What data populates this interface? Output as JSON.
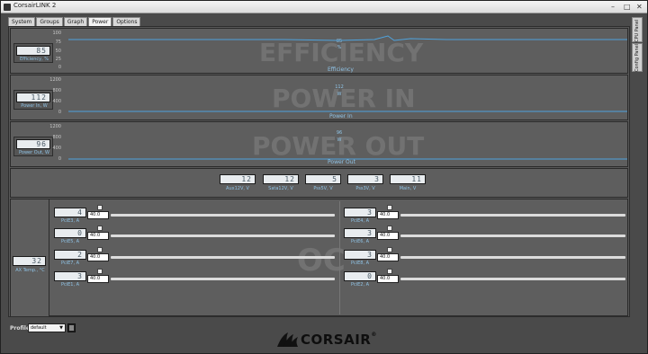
{
  "window": {
    "title": "CorsairLINK 2",
    "min": "–",
    "max": "□",
    "close": "✕"
  },
  "tabs": [
    {
      "label": "System"
    },
    {
      "label": "Groups"
    },
    {
      "label": "Graph"
    },
    {
      "label": "Power"
    },
    {
      "label": "Options"
    }
  ],
  "side_tabs": {
    "config": "Config Panel",
    "cpu": "CPU Panel"
  },
  "gauges": {
    "efficiency": {
      "value": "85",
      "label": "Efficiency, %"
    },
    "power_in": {
      "value": "112",
      "label": "Power In, W"
    },
    "power_out": {
      "value": "96",
      "label": "Power Out, W"
    },
    "temp": {
      "value": "32",
      "label": "AX Temp., °C"
    }
  },
  "charts": {
    "efficiency": {
      "watermark": "EFFICIENCY",
      "caption": "Efficiency",
      "mid_value": "85",
      "mid_unit": "%",
      "ticks": [
        "100",
        "75",
        "50",
        "25",
        "0"
      ]
    },
    "power_in": {
      "watermark": "POWER IN",
      "caption": "Power In",
      "mid_value": "112",
      "mid_unit": "W",
      "ticks": [
        "1200",
        "800",
        "400",
        "0"
      ]
    },
    "power_out": {
      "watermark": "POWER OUT",
      "caption": "Power Out",
      "mid_value": "96",
      "mid_unit": "W",
      "ticks": [
        "1200",
        "800",
        "400",
        "0"
      ]
    }
  },
  "rails": [
    {
      "value": "12",
      "label": "Aux12V, V"
    },
    {
      "value": "12",
      "label": "Sata12V, V"
    },
    {
      "value": "5",
      "label": "Pss5V, V"
    },
    {
      "value": "3",
      "label": "Pss3V, V"
    },
    {
      "value": "11",
      "label": "Main, V"
    }
  ],
  "pcie_left": [
    {
      "value": "4",
      "label": "PciE3, A",
      "input": "40.0"
    },
    {
      "value": "0",
      "label": "PciE5, A",
      "input": "40.0"
    },
    {
      "value": "2",
      "label": "PciE7, A",
      "input": "40.0"
    },
    {
      "value": "3",
      "label": "PciE1, A",
      "input": "40.0"
    }
  ],
  "pcie_right": [
    {
      "value": "3",
      "label": "PciE4, A",
      "input": "40.0"
    },
    {
      "value": "3",
      "label": "PciE6, A",
      "input": "40.0"
    },
    {
      "value": "3",
      "label": "PciE8, A",
      "input": "40.0"
    },
    {
      "value": "0",
      "label": "PciE2, A",
      "input": "40.0"
    }
  ],
  "oc_watermark": "OC",
  "profile": {
    "label": "Profile:",
    "selected": "default"
  },
  "brand": {
    "name": "CORSAIR",
    "reg": "®"
  }
}
